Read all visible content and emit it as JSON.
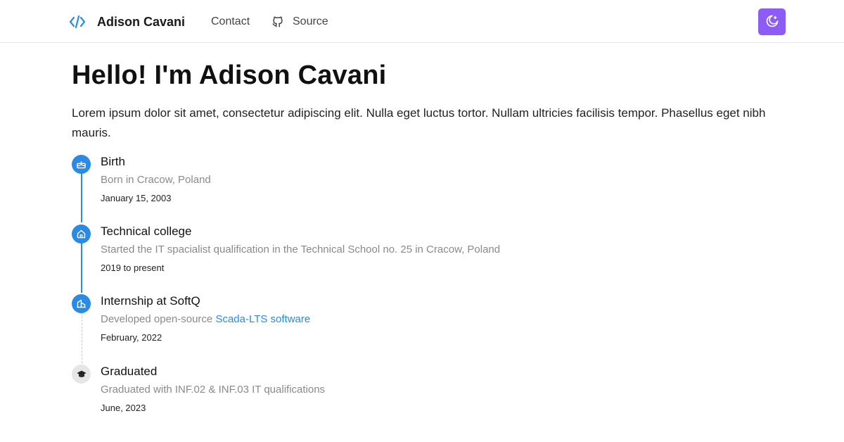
{
  "nav": {
    "brand_name": "Adison Cavani",
    "brand_icon": "code-icon",
    "contact_label": "Contact",
    "source_label": "Source",
    "source_icon": "github-icon",
    "theme_toggle_icon": "moon-icon"
  },
  "hero": {
    "title": "Hello! I'm Adison Cavani",
    "intro": "Lorem ipsum dolor sit amet, consectetur adipiscing elit. Nulla eget luctus tortor. Nullam ultricies facilisis tempor. Phasellus eget nibh mauris."
  },
  "timeline": {
    "items": [
      {
        "title": "Birth",
        "description": "Born in Cracow, Poland",
        "date": "January 15, 2003",
        "icon": "cake-icon"
      },
      {
        "title": "Technical college",
        "description": "Started the IT spacialist qualification in the Technical School no. 25 in Cracow, Poland",
        "date": "2019 to present",
        "icon": "school-icon"
      },
      {
        "title": "Internship at SoftQ",
        "description_prefix": "Developed open-source",
        "link_label": "Scada-LTS software",
        "date": "February, 2022",
        "icon": "building-icon"
      },
      {
        "title": "Graduated",
        "description": "Graduated with INF.02 & INF.03 IT qualifications",
        "date": "June, 2023",
        "icon": "graduation-cap-icon"
      }
    ]
  },
  "colors": {
    "accent": "#2b8ae3",
    "toggle": "#8c5cf5",
    "muted": "#8a8a8a"
  }
}
